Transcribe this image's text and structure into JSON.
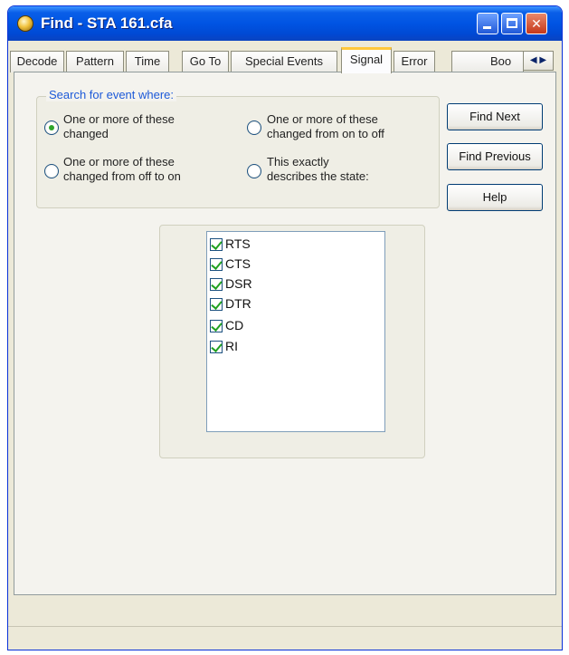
{
  "window": {
    "title": "Find - STA 161.cfa"
  },
  "tabs": [
    {
      "label": "Decode"
    },
    {
      "label": "Pattern"
    },
    {
      "label": "Time"
    },
    {
      "label": "Go To"
    },
    {
      "label": "Special Events"
    },
    {
      "label": "Signal"
    },
    {
      "label": "Error"
    },
    {
      "label": "Boo"
    }
  ],
  "active_tab": "Signal",
  "search": {
    "legend": "Search for event where:",
    "options": [
      {
        "label_line1": "One or more of these",
        "label_line2": "changed",
        "checked": true
      },
      {
        "label_line1": "One or more of these",
        "label_line2": "changed from on to off",
        "checked": false
      },
      {
        "label_line1": "One or more of these",
        "label_line2": "changed from off to on",
        "checked": false
      },
      {
        "label_line1": "This exactly",
        "label_line2": "describes the state:",
        "checked": false
      }
    ]
  },
  "buttons": {
    "find_next": "Find Next",
    "find_previous": "Find Previous",
    "help": "Help"
  },
  "signals": [
    {
      "label": "RTS",
      "checked": true
    },
    {
      "label": "CTS",
      "checked": true
    },
    {
      "label": "DSR",
      "checked": true
    },
    {
      "label": "DTR",
      "checked": true
    },
    {
      "label": "CD",
      "checked": true
    },
    {
      "label": "RI",
      "checked": true
    }
  ],
  "icons": {
    "app": "lightbulb-icon",
    "minimize": "minimize-icon",
    "maximize": "maximize-icon",
    "close": "close-icon",
    "tab_scroll": "tab-scroll-arrows-icon"
  },
  "colors": {
    "titlebar": "#0054e3",
    "legend_text": "#1d5ad8",
    "checkmark": "#21a121",
    "radio_dot": "#2fa52a"
  }
}
